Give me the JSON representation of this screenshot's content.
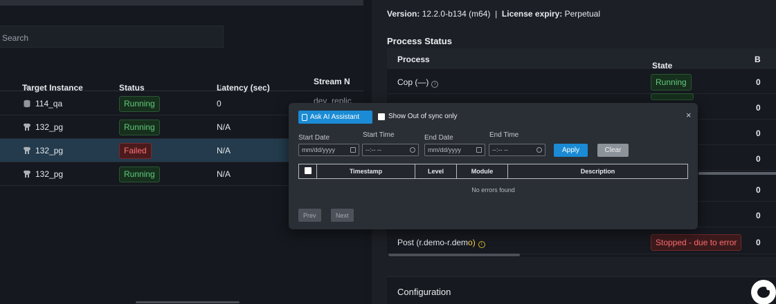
{
  "left": {
    "search_placeholder": "Search",
    "columns": {
      "target_instance": "Target Instance",
      "status": "Status",
      "latency": "Latency (sec)",
      "stream": "Stream N"
    },
    "sort_glyph": "↕",
    "rows": [
      {
        "instance": "114_qa",
        "status": "Running",
        "latency": "0",
        "stream": "dev_replic"
      },
      {
        "instance": "132_pg",
        "status": "Running",
        "latency": "N/A",
        "stream": ""
      },
      {
        "instance": "132_pg",
        "status": "Failed",
        "latency": "N/A",
        "stream": ""
      },
      {
        "instance": "132_pg",
        "status": "Running",
        "latency": "N/A",
        "stream": ""
      }
    ]
  },
  "right": {
    "version_label": "Version:",
    "version_value": "12.2.0-b134 (m64)",
    "separator": "|",
    "license_label": "License expiry:",
    "license_value": "Perpetual",
    "process_status_title": "Process Status",
    "process_table": {
      "columns": {
        "process": "Process",
        "state": "State",
        "b": "B"
      },
      "rows": [
        {
          "process": "Cop (—)",
          "state": "Running",
          "b": "0"
        },
        {
          "process": "",
          "state": "",
          "b": "0"
        },
        {
          "process": "",
          "state": "",
          "b": "0"
        },
        {
          "process": "",
          "state": "",
          "b": "0"
        },
        {
          "process": "",
          "state": "",
          "b": "0"
        },
        {
          "process": "",
          "state": "",
          "b": "0"
        },
        {
          "process_prefix": "Post (r.demo-r.dem",
          "process_highlight": "o",
          "process_suffix": ")",
          "state": "Stopped - due to error",
          "b": "0"
        }
      ]
    },
    "configuration_title": "Configuration"
  },
  "modal": {
    "ask_ai_label": "Ask AI Assistant",
    "show_out_of_sync_label": "Show Out of sync only",
    "close_glyph": "×",
    "start_date_label": "Start Date",
    "start_time_label": "Start Time",
    "end_date_label": "End Date",
    "end_time_label": "End Time",
    "date_placeholder": "mm/dd/yyyy",
    "time_placeholder": "--:-- --",
    "apply_label": "Apply",
    "clear_label": "Clear",
    "grid_columns": {
      "timestamp": "Timestamp",
      "level": "Level",
      "module": "Module",
      "description": "Description"
    },
    "empty_message": "No errors found",
    "prev_label": "Prev",
    "next_label": "Next"
  },
  "colors": {
    "accent": "#1a8bd4",
    "running": "#63c77c",
    "failed": "#ff7276",
    "selected_row": "#233b4c"
  },
  "icons": [
    "database-icon",
    "elephant-icon",
    "info-icon",
    "sort-icon",
    "close-icon",
    "calendar-icon",
    "clock-icon",
    "chat-icon",
    "ai-assistant-icon"
  ]
}
